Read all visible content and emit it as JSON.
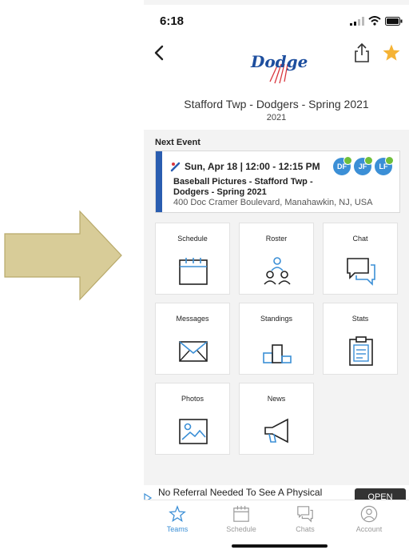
{
  "status_bar": {
    "time": "6:18"
  },
  "team": {
    "name": "Stafford Twp - Dodgers - Spring 2021",
    "season": "2021",
    "logo_text": "Dodgers"
  },
  "next_event": {
    "heading": "Next Event",
    "date": "Sun, Apr 18 | 12:00 - 12:15 PM",
    "title": "Baseball Pictures - Stafford Twp - Dodgers - Spring 2021",
    "address": "400 Doc Cramer Boulevard, Manahawkin, NJ, USA",
    "attendees": [
      "DF",
      "JF",
      "LF"
    ]
  },
  "tiles": [
    {
      "label": "Schedule",
      "icon": "calendar-icon"
    },
    {
      "label": "Roster",
      "icon": "people-icon"
    },
    {
      "label": "Chat",
      "icon": "chat-bubbles-icon"
    },
    {
      "label": "Messages",
      "icon": "envelope-icon"
    },
    {
      "label": "Standings",
      "icon": "podium-icon"
    },
    {
      "label": "Stats",
      "icon": "clipboard-icon"
    },
    {
      "label": "Photos",
      "icon": "picture-icon"
    },
    {
      "label": "News",
      "icon": "megaphone-icon"
    }
  ],
  "ad": {
    "text": "No Referral Needed To See A Physical",
    "button": "OPEN"
  },
  "tabbar": [
    {
      "label": "Teams",
      "icon": "star-outline-icon",
      "active": true
    },
    {
      "label": "Schedule",
      "icon": "calendar-icon",
      "active": false
    },
    {
      "label": "Chats",
      "icon": "chat-bubbles-icon",
      "active": false
    },
    {
      "label": "Account",
      "icon": "account-icon",
      "active": false
    }
  ],
  "colors": {
    "accent": "#3b8fd6",
    "event_stripe": "#2a5db0",
    "star": "#f5b335",
    "arrow": "#d8cc98"
  }
}
